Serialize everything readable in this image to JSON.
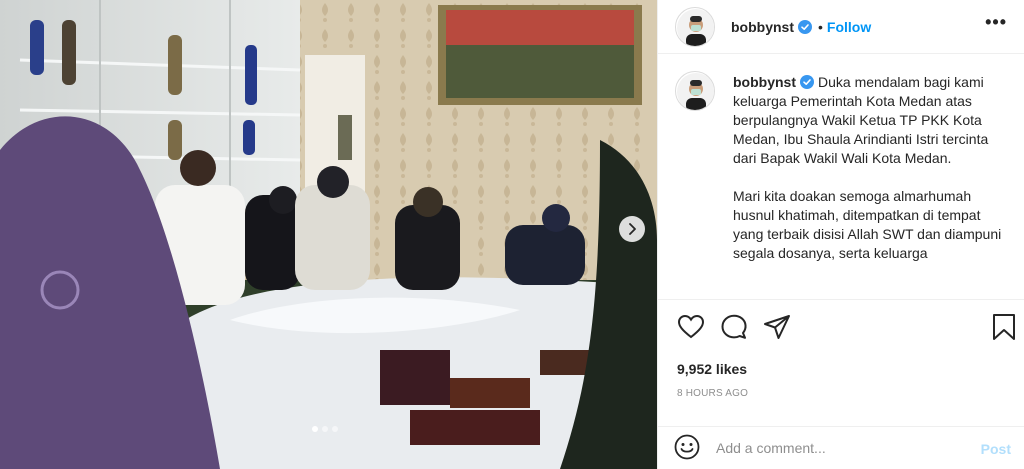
{
  "post": {
    "username": "bobbynst",
    "verified": true,
    "follow_label": "Follow",
    "more_icon": "more-options-icon",
    "bullet": "•",
    "caption_paragraphs": [
      "Duka mendalam bagi kami keluarga Pemerintah Kota Medan atas berpulangnya Wakil Ketua TP PKK Kota Medan, Ibu Shaula Arindianti Istri tercinta dari Bapak Wakil Wali Kota Medan.",
      "Mari kita doakan semoga almarhumah husnul khatimah, ditempatkan di tempat yang terbaik disisi Allah SWT dan diampuni segala dosanya, serta keluarga"
    ],
    "likes": "9,952 likes",
    "timestamp": "8 HOURS AGO",
    "carousel": {
      "slide_count": 3,
      "active_index": 0
    }
  },
  "comment": {
    "placeholder": "Add a comment...",
    "post_label": "Post"
  },
  "colors": {
    "accent": "#0095f6",
    "post_disabled": "#b2dffc",
    "text": "#262626",
    "muted": "#8e8e8e",
    "border": "#efefef"
  }
}
